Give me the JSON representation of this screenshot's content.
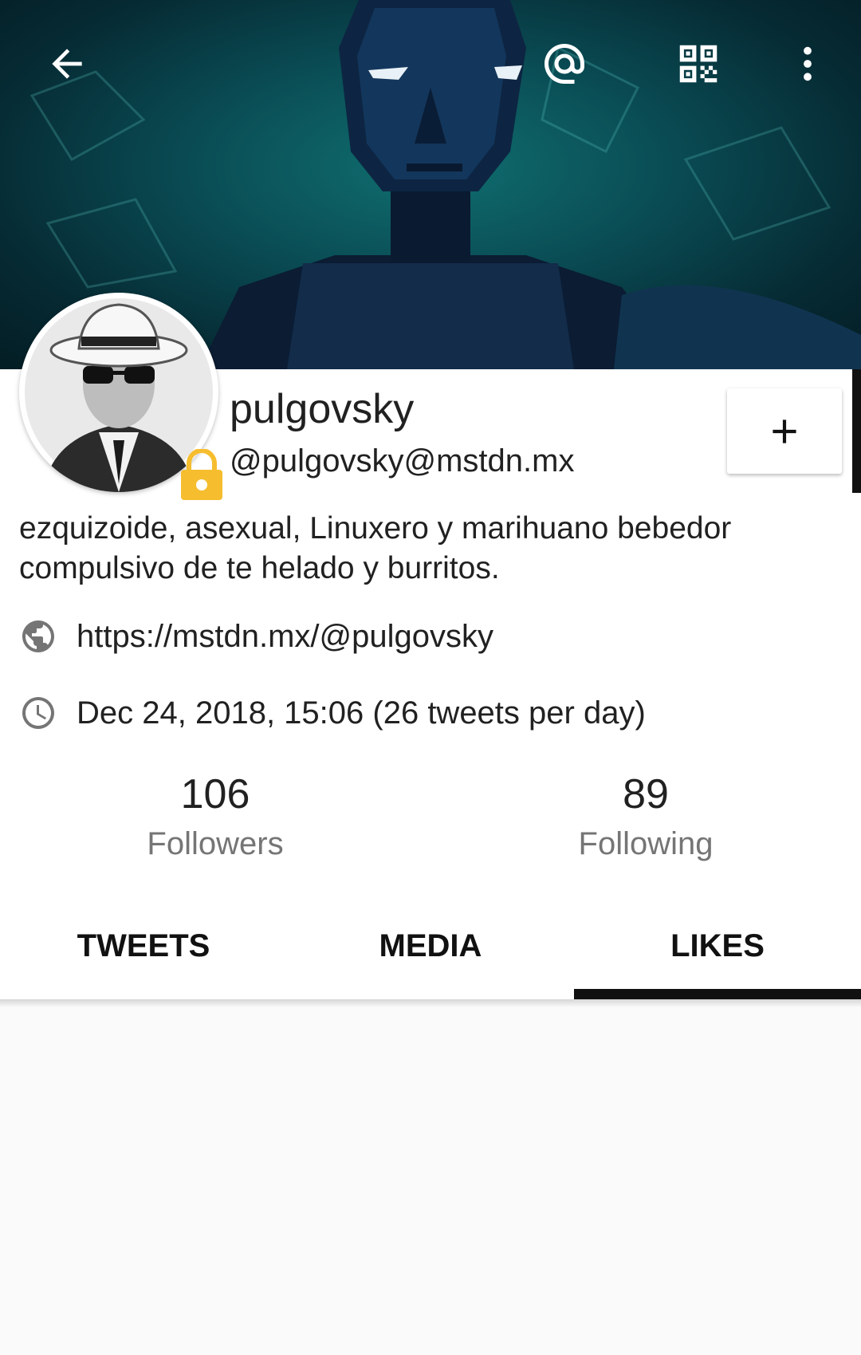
{
  "toolbar": {
    "back_icon": "arrow-left-icon",
    "mention_icon": "at-sign-icon",
    "qr_icon": "qr-code-icon",
    "more_icon": "more-vertical-icon"
  },
  "profile": {
    "display_name": "pulgovsky",
    "handle": "@pulgovsky@mstdn.mx",
    "bio": "ezquizoide, asexual, Linuxero y marihuano bebedor compulsivo de te helado y burritos.",
    "website": "https://mstdn.mx/@pulgovsky",
    "joined": "Dec 24, 2018, 15:06 (26 tweets per day)",
    "locked": true
  },
  "stats": {
    "followers_count": "106",
    "followers_label": "Followers",
    "following_count": "89",
    "following_label": "Following"
  },
  "tabs": [
    {
      "label": "TWEETS",
      "active": false
    },
    {
      "label": "MEDIA",
      "active": false
    },
    {
      "label": "LIKES",
      "active": true
    }
  ],
  "colors": {
    "lock": "#f6bd2f",
    "tab_indicator": "#111111",
    "banner": "#0a4d55"
  }
}
